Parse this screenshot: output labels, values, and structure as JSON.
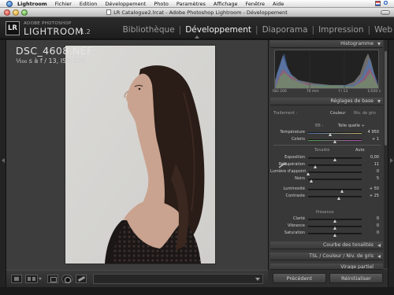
{
  "menubar": {
    "app": "Lightroom",
    "items": [
      "Fichier",
      "Edition",
      "Développement",
      "Photo",
      "Paramètres",
      "Affichage",
      "Fenêtre",
      "Aide"
    ]
  },
  "window": {
    "title": "LR Catalogue2.lrcat - Adobe Photoshop Lightroom - Développement"
  },
  "header": {
    "badge": "LR",
    "brand_small": "ADOBE PHOTOSHOP",
    "brand_big": "LIGHTROOM",
    "version": "1.2",
    "modules": [
      {
        "label": "Bibliothèque"
      },
      {
        "label": "Développement",
        "active": true
      },
      {
        "label": "Diaporama"
      },
      {
        "label": "Impression"
      },
      {
        "label": "Web"
      }
    ],
    "separator": "|"
  },
  "photo": {
    "filename": "DSC_4608.NEF",
    "exif": "¹⁄₅₀₀ s à f / 13, ISO 200",
    "description_colors": {
      "background": "#d7d6d3",
      "dress": "#1b1716",
      "hair": "#2a1c17",
      "skin": "#c9a38f"
    }
  },
  "panel": {
    "histogram": {
      "title": "Histogramme",
      "meta": [
        "ISO 200",
        "70 mm",
        "f / 13",
        "1/500 s"
      ]
    },
    "basic": {
      "title": "Réglages de base",
      "treatment_label": "Traitement :",
      "treatment_options": [
        "Couleur",
        "Niv. de gris"
      ],
      "wb_label": "BB :",
      "wb_value": "Telle quelle ÷",
      "rows_wb": [
        {
          "label": "Température",
          "value": "4 950",
          "pos": 0.42
        },
        {
          "label": "Coloris",
          "value": "+ 1",
          "pos": 0.5
        }
      ],
      "tone_title": "Tonalité",
      "tone_auto": "Auto",
      "rows_tone": [
        {
          "label": "Exposition",
          "value": "0,00",
          "pos": 0.5
        },
        {
          "label": "Récupération",
          "value": "11",
          "pos": 0.14
        },
        {
          "label": "Lumière d'appoint",
          "value": "0",
          "pos": 0.0
        },
        {
          "label": "Noirs",
          "value": "5",
          "pos": 0.07
        }
      ],
      "rows_tone2": [
        {
          "label": "Luminosité",
          "value": "+ 50",
          "pos": 0.64
        },
        {
          "label": "Contraste",
          "value": "+ 25",
          "pos": 0.58
        }
      ],
      "presence_title": "Présence",
      "rows_presence": [
        {
          "label": "Clarté",
          "value": "0",
          "pos": 0.5
        },
        {
          "label": "Vibrance",
          "value": "0",
          "pos": 0.5
        },
        {
          "label": "Saturation",
          "value": "0",
          "pos": 0.5
        }
      ]
    },
    "curve_title": "Courbe des tonalités",
    "tsl_title": "TSL / Couleur / Niv. de gris",
    "split_title": "Virage partiel"
  },
  "buttons": {
    "previous": "Précédent",
    "reset": "Réinitialiser"
  }
}
